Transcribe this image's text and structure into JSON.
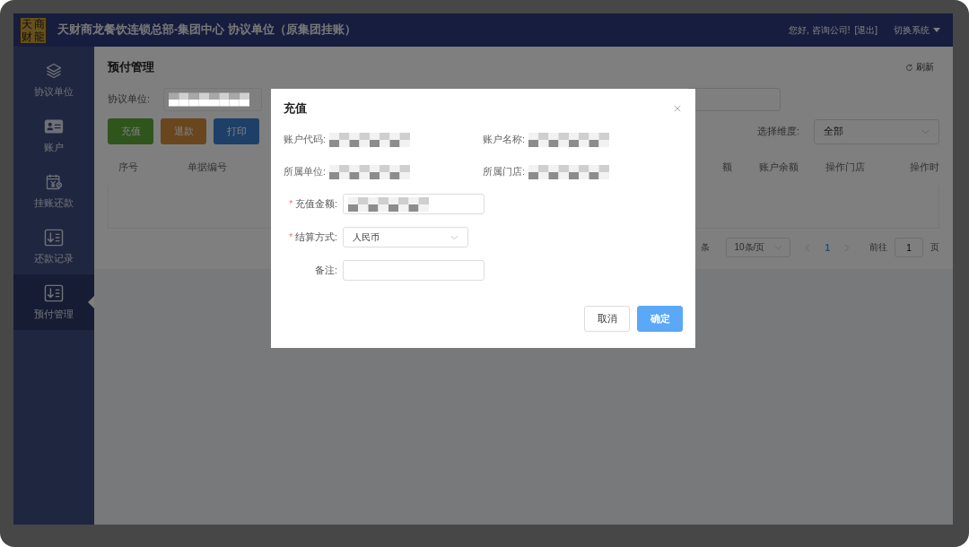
{
  "header": {
    "logo": [
      "天",
      "商",
      "财",
      "龍"
    ],
    "title": "天财商龙餐饮连锁总部-集团中心 协议单位（原集团挂账）",
    "greeting": "您好, 咨询公司!",
    "logout": "[退出]",
    "switch_system": "切换系统"
  },
  "sidebar": {
    "items": [
      {
        "label": "协议单位",
        "selected": false
      },
      {
        "label": "账户",
        "selected": false
      },
      {
        "label": "挂账还款",
        "selected": false
      },
      {
        "label": "还款记录",
        "selected": false
      },
      {
        "label": "预付管理",
        "selected": true
      }
    ]
  },
  "page": {
    "title": "预付管理",
    "refresh": "刷新",
    "filter": {
      "label": "协议单位:",
      "redacted": true
    },
    "buttons": [
      {
        "label": "充值",
        "kind": "success"
      },
      {
        "label": "退款",
        "kind": "warning"
      },
      {
        "label": "打印",
        "kind": "primary"
      }
    ],
    "dimension": {
      "label": "选择维度:",
      "value": "全部"
    },
    "table": {
      "columns_left": [
        "序号",
        "单据编号"
      ],
      "columns_right": [
        "额",
        "账户余额",
        "操作门店",
        "操作时"
      ]
    },
    "pagination": {
      "total_suffix": "条",
      "page_size": "10条/页",
      "current": "1",
      "goto_label": "前往",
      "goto_value": "1",
      "goto_suffix": "页"
    }
  },
  "dialog": {
    "title": "充值",
    "info": [
      {
        "label": "账户代码:",
        "redacted": true
      },
      {
        "label": "账户名称:",
        "redacted": true
      },
      {
        "label": "所属单位:",
        "redacted": true
      },
      {
        "label": "所属门店:",
        "redacted": true
      }
    ],
    "form": [
      {
        "label": "充值金额:",
        "kind": "input",
        "required_mark": "*",
        "redacted": true
      },
      {
        "label": "结算方式:",
        "kind": "select",
        "required_mark": "*",
        "value": "人民币"
      },
      {
        "label": "备注:",
        "kind": "input"
      }
    ],
    "buttons": [
      {
        "label": "取消",
        "primary": false
      },
      {
        "label": "确定",
        "primary": true
      }
    ]
  }
}
